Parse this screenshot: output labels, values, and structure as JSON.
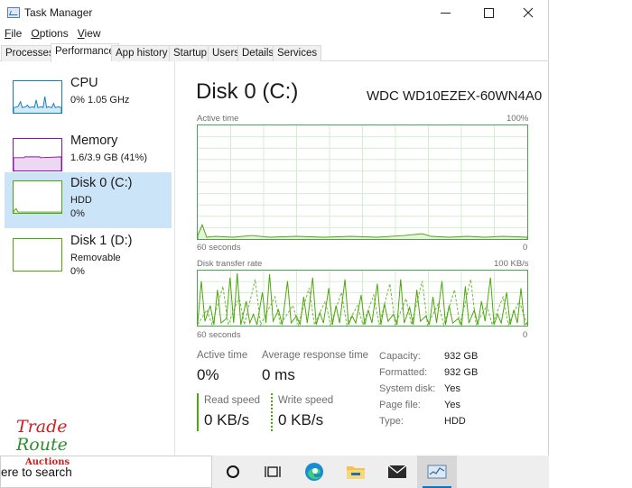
{
  "window": {
    "title": "Task Manager",
    "icon": "task-manager-icon"
  },
  "menu": [
    {
      "label": "File",
      "mnemonic": "F",
      "rest": "ile"
    },
    {
      "label": "Options",
      "mnemonic": "O",
      "rest": "ptions"
    },
    {
      "label": "View",
      "mnemonic": "V",
      "rest": "iew"
    }
  ],
  "tabs": [
    "Processes",
    "Performance",
    "App history",
    "Startup",
    "Users",
    "Details",
    "Services"
  ],
  "active_tab": "Performance",
  "resources": [
    {
      "name": "CPU",
      "lines": [
        "0%  1.05 GHz"
      ],
      "color": "#117dbb"
    },
    {
      "name": "Memory",
      "lines": [
        "1.6/3.9 GB (41%)"
      ],
      "color": "#8b12ae"
    },
    {
      "name": "Disk 0 (C:)",
      "lines": [
        "HDD",
        "0%"
      ],
      "color": "#4da60c",
      "selected": true
    },
    {
      "name": "Disk 1 (D:)",
      "lines": [
        "Removable",
        "0%"
      ],
      "color": "#4da60c"
    }
  ],
  "detail": {
    "title": "Disk 0 (C:)",
    "model": "WDC WD10EZEX-60WN4A0",
    "active_time_graph": {
      "label": "Active time",
      "max_label": "100%",
      "left_axis": "60 seconds",
      "right_axis": "0"
    },
    "transfer_graph": {
      "label": "Disk transfer rate",
      "max_label": "100 KB/s",
      "left_axis": "60 seconds",
      "right_axis": "0"
    },
    "stats": {
      "active_time_label": "Active time",
      "active_time_value": "0%",
      "avg_response_label": "Average response time",
      "avg_response_value": "0 ms",
      "read_speed_label": "Read speed",
      "read_speed_value": "0 KB/s",
      "write_speed_label": "Write speed",
      "write_speed_value": "0 KB/s"
    },
    "properties": [
      {
        "label": "Capacity:",
        "value": "932 GB"
      },
      {
        "label": "Formatted:",
        "value": "932 GB"
      },
      {
        "label": "System disk:",
        "value": "Yes"
      },
      {
        "label": "Page file:",
        "value": "Yes"
      },
      {
        "label": "Type:",
        "value": "HDD"
      }
    ]
  },
  "watermark": {
    "line1": "Trade",
    "line2": "Route",
    "line3": "Auctions"
  },
  "taskbar": {
    "search_text": "ere to search",
    "icons": [
      "cortana-circle-icon",
      "task-view-icon",
      "edge-icon",
      "file-explorer-icon",
      "mail-icon",
      "task-manager-icon"
    ]
  },
  "colors": {
    "disk_green": "#4da60c",
    "selection_blue": "#cce4f7",
    "cpu_blue": "#117dbb",
    "memory_purple": "#8b12ae"
  }
}
